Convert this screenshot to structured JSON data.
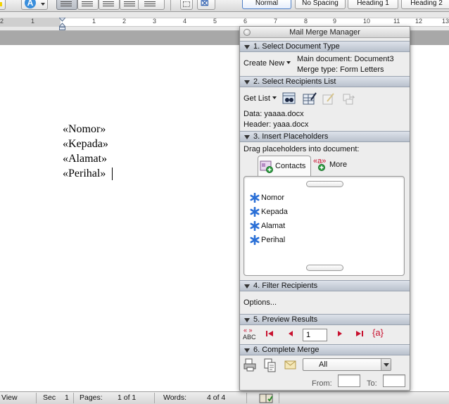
{
  "toolbar": {
    "styles": [
      "Normal",
      "No Spacing",
      "Heading 1",
      "Heading 2"
    ],
    "selected_style": "Normal"
  },
  "ruler": {
    "numbers": [
      "2",
      "1",
      "1",
      "2",
      "3",
      "4",
      "5",
      "6",
      "7",
      "8",
      "9",
      "10",
      "11",
      "12",
      "13"
    ]
  },
  "document": {
    "merge_fields": [
      "«Nomor»",
      "«Kepada»",
      "«Alamat»",
      "«Perihal»"
    ]
  },
  "statusbar": {
    "view_label": "View",
    "sec_label": "Sec",
    "sec_value": "1",
    "pages_label": "Pages:",
    "pages_value": "1 of 1",
    "words_label": "Words:",
    "words_value": "4 of 4"
  },
  "mail_merge_manager": {
    "title": "Mail Merge Manager",
    "section1": {
      "title": "1. Select Document Type",
      "create_new_label": "Create New",
      "main_document": "Main document: Document3",
      "merge_type": "Merge type: Form Letters"
    },
    "section2": {
      "title": "2. Select Recipients List",
      "get_list_label": "Get List",
      "data_file": "Data: yaaaa.docx",
      "header_file": "Header: yaaa.docx"
    },
    "section3": {
      "title": "3. Insert Placeholders",
      "instruction": "Drag placeholders into document:",
      "tab_contacts": "Contacts",
      "tab_more": "More",
      "more_icon_text": "«a»",
      "placeholders": [
        "Nomor",
        "Kepada",
        "Alamat",
        "Perihal"
      ]
    },
    "section4": {
      "title": "4. Filter Recipients",
      "options_label": "Options..."
    },
    "section5": {
      "title": "5. Preview Results",
      "abc_top": "« »",
      "abc_bottom": "ABC",
      "record_number": "1",
      "field_icon_text": "{a}"
    },
    "section6": {
      "title": "6. Complete Merge",
      "merge_to_value": "All",
      "from_label": "From:",
      "to_label": "To:"
    }
  },
  "colors": {
    "section_header": "#c9d0da",
    "nav_red": "#c8102e",
    "placeholder_star": "#2a6fd6"
  }
}
